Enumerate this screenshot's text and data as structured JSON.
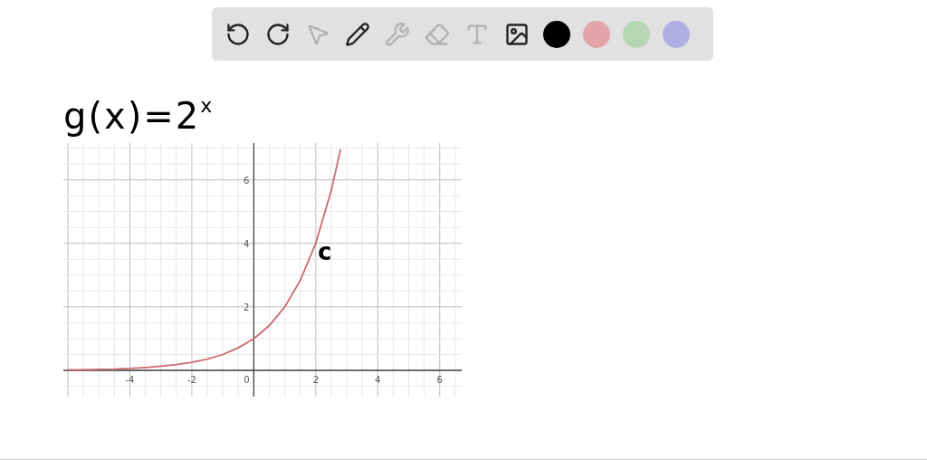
{
  "toolbar": {
    "tools": [
      {
        "kind": "undo",
        "disabled": false
      },
      {
        "kind": "redo",
        "disabled": false
      },
      {
        "kind": "select",
        "disabled": true
      },
      {
        "kind": "pen",
        "disabled": false
      },
      {
        "kind": "tools",
        "disabled": true
      },
      {
        "kind": "eraser",
        "disabled": true
      },
      {
        "kind": "text",
        "disabled": true
      },
      {
        "kind": "image",
        "disabled": false
      }
    ],
    "colors": [
      {
        "color": "#000000"
      },
      {
        "color": "#e3a5a8"
      },
      {
        "color": "#b4d6b2"
      },
      {
        "color": "#b0aee5"
      }
    ]
  },
  "heading": "g(x)=2$^{x}$",
  "annotation": "c",
  "graph": {
    "chart_data": {
      "type": "line",
      "x": [
        -6,
        -5.5,
        -5,
        -4.5,
        -4,
        -3.5,
        -3,
        -2.5,
        -2,
        -1.5,
        -1,
        -0.5,
        0,
        0.5,
        1,
        1.5,
        2,
        2.5,
        2.8
      ],
      "series": [
        {
          "color": "#c96b70",
          "values": [
            0.02,
            0.02,
            0.03,
            0.04,
            0.06,
            0.09,
            0.13,
            0.18,
            0.25,
            0.35,
            0.5,
            0.71,
            1,
            1.41,
            2,
            2.83,
            4,
            5.66,
            6.96
          ]
        }
      ],
      "grid": true,
      "xlim": [
        -6,
        6.65
      ],
      "ylim": [
        -0.77,
        7.1
      ],
      "xticks": [
        -4,
        -2,
        2,
        4,
        6
      ],
      "yticks": [
        2,
        4,
        6
      ]
    },
    "origin_label": "0"
  }
}
